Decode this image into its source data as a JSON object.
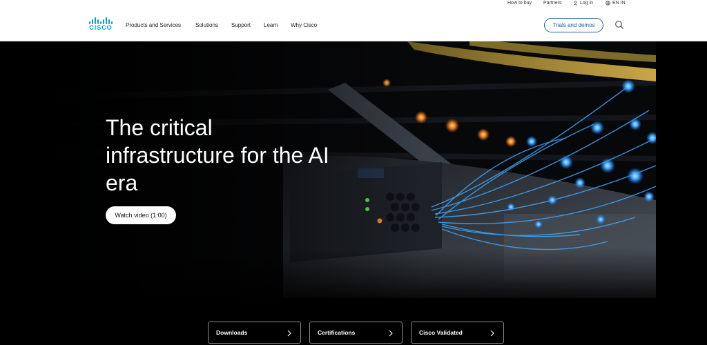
{
  "utility": {
    "how_to_buy": "How to buy",
    "partners": "Partners",
    "login": "Log in",
    "language": "EN IN"
  },
  "header": {
    "logo_text": "CISCO",
    "nav": [
      "Products and Services",
      "Solutions",
      "Support",
      "Learn",
      "Why Cisco"
    ],
    "trials_label": "Trials and demos",
    "search_icon": "search-icon"
  },
  "hero": {
    "headline": "The critical infrastructure for the AI era",
    "watch_label": "Watch video (1:00)"
  },
  "quick_links": [
    {
      "label": "Downloads"
    },
    {
      "label": "Certifications"
    },
    {
      "label": "Cisco Validated"
    }
  ],
  "colors": {
    "brand": "#049fd9",
    "button_blue": "#1b5fa8",
    "fiber_blue": "#3fa8ff"
  }
}
